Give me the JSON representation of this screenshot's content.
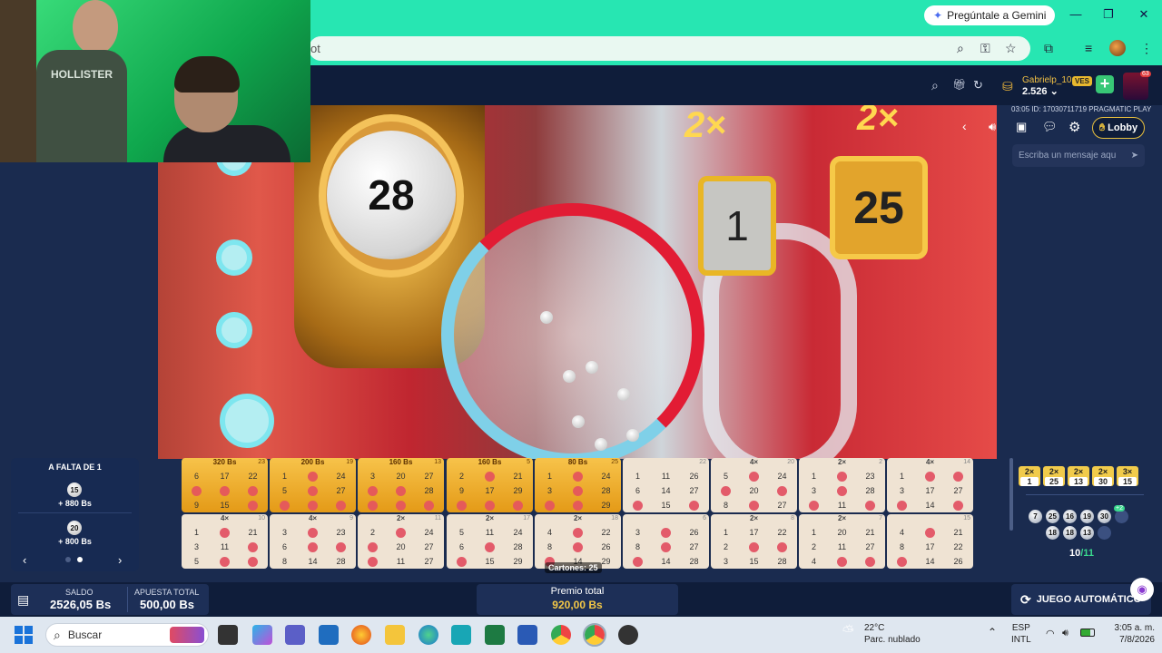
{
  "browser": {
    "gemini_button": "Pregúntale a Gemini",
    "url_fragment": "ot"
  },
  "site": {
    "username": "Gabrielp_10",
    "currency_badge": "VES",
    "balance_short": "2.526",
    "notification_count": "63",
    "game_info": "03:05 ID: 17030711719 PRAGMATIC PLAY",
    "lobby_label": "Lobby",
    "chat_placeholder": "Escriba un mensaje aqu"
  },
  "stage": {
    "current_ball": "28",
    "sign_left_multiplier": "2×",
    "sign_left_number": "1",
    "sign_right_multiplier": "2×",
    "sign_right_number": "25"
  },
  "webcam": {
    "shirt_text": "HOLLISTER"
  },
  "left_panel": {
    "title": "A FALTA DE 1",
    "items": [
      {
        "ball": "15",
        "prize": "+ 880 Bs"
      },
      {
        "ball": "20",
        "prize": "+ 800 Bs"
      }
    ]
  },
  "cards_row1": [
    {
      "header": "320 Bs",
      "num": "23",
      "gold": true,
      "cells": [
        "6",
        "17",
        "22",
        "",
        "",
        "",
        "9",
        "15",
        ""
      ]
    },
    {
      "header": "200 Bs",
      "num": "19",
      "gold": true,
      "cells": [
        "1",
        "",
        "24",
        "5",
        "",
        "27",
        "",
        "",
        ""
      ]
    },
    {
      "header": "160 Bs",
      "num": "13",
      "gold": true,
      "cells": [
        "3",
        "20",
        "27",
        "",
        "",
        "28",
        "",
        "",
        ""
      ]
    },
    {
      "header": "160 Bs",
      "num": "5",
      "gold": true,
      "cells": [
        "2",
        "",
        "21",
        "9",
        "17",
        "29",
        "",
        "",
        ""
      ]
    },
    {
      "header": "80 Bs",
      "num": "25",
      "gold": true,
      "cells": [
        "1",
        "",
        "24",
        "3",
        "",
        "28",
        "",
        "",
        "29"
      ]
    },
    {
      "header": "",
      "num": "22",
      "gold": false,
      "cells": [
        "1",
        "11",
        "26",
        "6",
        "14",
        "27",
        "",
        "15",
        ""
      ]
    },
    {
      "header": "4×",
      "num": "20",
      "gold": false,
      "cells": [
        "5",
        "",
        "24",
        "",
        "20",
        "",
        "8",
        "",
        "27"
      ]
    },
    {
      "header": "2×",
      "num": "2",
      "gold": false,
      "cells": [
        "1",
        "",
        "23",
        "3",
        "",
        "28",
        "",
        "11",
        ""
      ]
    },
    {
      "header": "4×",
      "num": "14",
      "gold": false,
      "cells": [
        "1",
        "",
        "",
        "3",
        "17",
        "27",
        "",
        "14",
        ""
      ]
    }
  ],
  "cards_row2": [
    {
      "header": "4×",
      "num": "10",
      "gold": false,
      "cells": [
        "1",
        "",
        "21",
        "3",
        "11",
        "",
        "5",
        "",
        ""
      ]
    },
    {
      "header": "4×",
      "num": "9",
      "gold": false,
      "cells": [
        "3",
        "",
        "23",
        "6",
        "",
        "",
        "8",
        "14",
        "28"
      ]
    },
    {
      "header": "2×",
      "num": "11",
      "gold": false,
      "cells": [
        "2",
        "",
        "24",
        "",
        "20",
        "27",
        "",
        "11",
        "27"
      ]
    },
    {
      "header": "2×",
      "num": "17",
      "gold": false,
      "cells": [
        "5",
        "11",
        "24",
        "6",
        "",
        "28",
        "",
        "15",
        "29"
      ]
    },
    {
      "header": "2×",
      "num": "18",
      "gold": false,
      "cells": [
        "4",
        "",
        "22",
        "8",
        "",
        "26",
        "",
        "14",
        "29"
      ]
    },
    {
      "header": "",
      "num": "6",
      "gold": false,
      "cells": [
        "3",
        "",
        "26",
        "8",
        "",
        "27",
        "",
        "14",
        "28"
      ]
    },
    {
      "header": "2×",
      "num": "8",
      "gold": false,
      "cells": [
        "1",
        "17",
        "22",
        "2",
        "",
        "",
        "3",
        "15",
        "28"
      ]
    },
    {
      "header": "2×",
      "num": "7",
      "gold": false,
      "cells": [
        "1",
        "20",
        "21",
        "2",
        "11",
        "27",
        "4",
        "",
        ""
      ]
    },
    {
      "header": "",
      "num": "15",
      "gold": false,
      "cells": [
        "4",
        "",
        "21",
        "8",
        "17",
        "22",
        "",
        "14",
        "26"
      ]
    }
  ],
  "cartones_label": "Cartones: 25",
  "right_panel": {
    "multipliers": [
      {
        "top": "2×",
        "bottom": "1"
      },
      {
        "top": "2×",
        "bottom": "25"
      },
      {
        "top": "2×",
        "bottom": "13"
      },
      {
        "top": "2×",
        "bottom": "30"
      },
      {
        "top": "3×",
        "bottom": "15"
      }
    ],
    "drawn_row1": [
      "7",
      "25",
      "16",
      "19",
      "30",
      ""
    ],
    "drawn_row2": [
      "18",
      "18",
      "13",
      ""
    ],
    "bonus_badge": "+2",
    "progress_current": "10",
    "progress_total": "/11"
  },
  "bottom": {
    "saldo_label": "SALDO",
    "saldo_value": "2526,05 Bs",
    "apuesta_label": "APUESTA TOTAL",
    "apuesta_value": "500,00 Bs",
    "premio_label": "Premio total",
    "premio_value": "920,00 Bs",
    "auto_label": "JUEGO AUTOMÁTICO"
  },
  "taskbar": {
    "search_label": "Buscar",
    "temperature": "22°C",
    "weather_desc": "Parc. nublado",
    "lang_top": "ESP",
    "lang_bottom": "INTL",
    "time": "3:05 a. m.",
    "date": "7/8/2026"
  },
  "colors": {
    "chrome_accent": "#27e6b2",
    "site_bg": "#1a2b4f",
    "gold": "#f1cb4b",
    "mark": "#e35b6a"
  }
}
